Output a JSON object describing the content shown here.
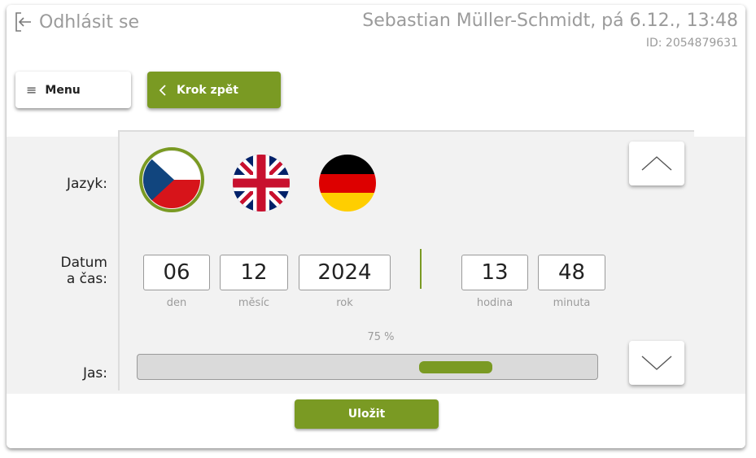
{
  "header": {
    "logout_label": "Odhlásit se",
    "user_info": "Sebastian Müller-Schmidt, pá 6.12., 13:48",
    "id_text": "ID: 2054879631"
  },
  "toolbar": {
    "menu_label": "Menu",
    "back_label": "Krok zpět"
  },
  "settings": {
    "language_label": "Jazyk:",
    "languages": [
      {
        "name": "cs-flag-icon",
        "selected": true
      },
      {
        "name": "uk-flag-icon",
        "selected": false
      },
      {
        "name": "de-flag-icon",
        "selected": false
      }
    ],
    "datetime_label_line1": "Datum",
    "datetime_label_line2": "a čas:",
    "day": "06",
    "month": "12",
    "year": "2024",
    "hour": "13",
    "minute": "48",
    "day_caption": "den",
    "month_caption": "měsíc",
    "year_caption": "rok",
    "hour_caption": "hodina",
    "minute_caption": "minuta",
    "brightness_label": "Jas:",
    "brightness_percent_text": "75 %",
    "brightness_value": 0.75
  },
  "footer": {
    "save_label": "Uložit"
  },
  "colors": {
    "accent": "#7a9a23",
    "muted_text": "#9b9b9b"
  }
}
